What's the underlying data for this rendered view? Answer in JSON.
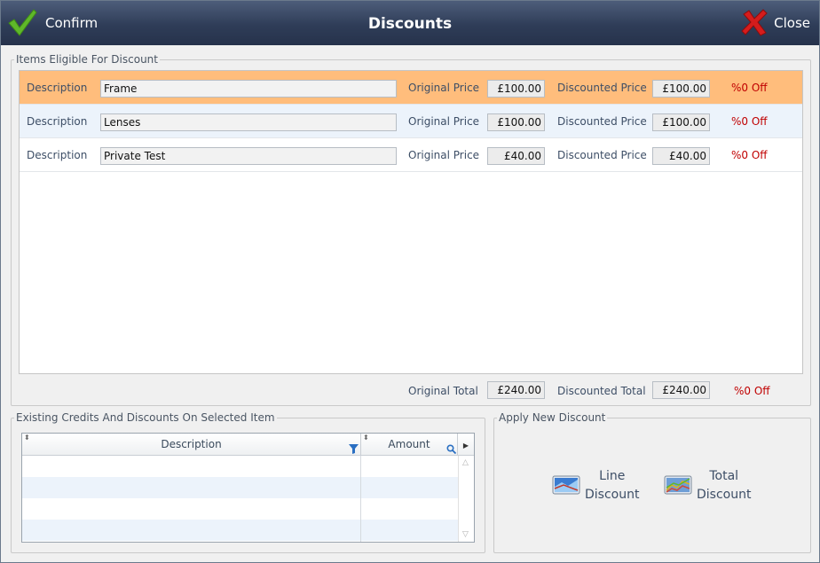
{
  "window": {
    "title": "Discounts",
    "confirm_label": "Confirm",
    "close_label": "Close"
  },
  "eligible": {
    "legend": "Items Eligible For Discount",
    "desc_label": "Description",
    "orig_label": "Original Price",
    "disc_label": "Discounted Price",
    "items": [
      {
        "description": "Frame",
        "original_price": "£100.00",
        "discounted_price": "£100.00",
        "off": "%0 Off",
        "selected": true
      },
      {
        "description": "Lenses",
        "original_price": "£100.00",
        "discounted_price": "£100.00",
        "off": "%0 Off"
      },
      {
        "description": "Private Test",
        "original_price": "£40.00",
        "discounted_price": "£40.00",
        "off": "%0 Off"
      }
    ],
    "totals": {
      "original_label": "Original Total",
      "original_value": "£240.00",
      "discounted_label": "Discounted Total",
      "discounted_value": "£240.00",
      "off": "%0 Off"
    }
  },
  "credits": {
    "legend": "Existing Credits And Discounts On Selected Item",
    "columns": [
      "Description",
      "Amount"
    ]
  },
  "apply": {
    "legend": "Apply New Discount",
    "line_label_1": "Line",
    "line_label_2": "Discount",
    "total_label_1": "Total",
    "total_label_2": "Discount"
  },
  "colors": {
    "title_bar": "#2f3d58",
    "selected_row": "#ffbd7c",
    "alt_row": "#ecf3fb",
    "off_text": "#c00000",
    "confirm_check": "#5fb82a",
    "close_x": "#d51c1c"
  },
  "icons": {
    "confirm": "checkmark-icon",
    "close": "red-x-icon",
    "filter": "filter-icon",
    "search": "magnifier-icon",
    "line_discount": "line-discount-icon",
    "total_discount": "total-discount-icon"
  }
}
